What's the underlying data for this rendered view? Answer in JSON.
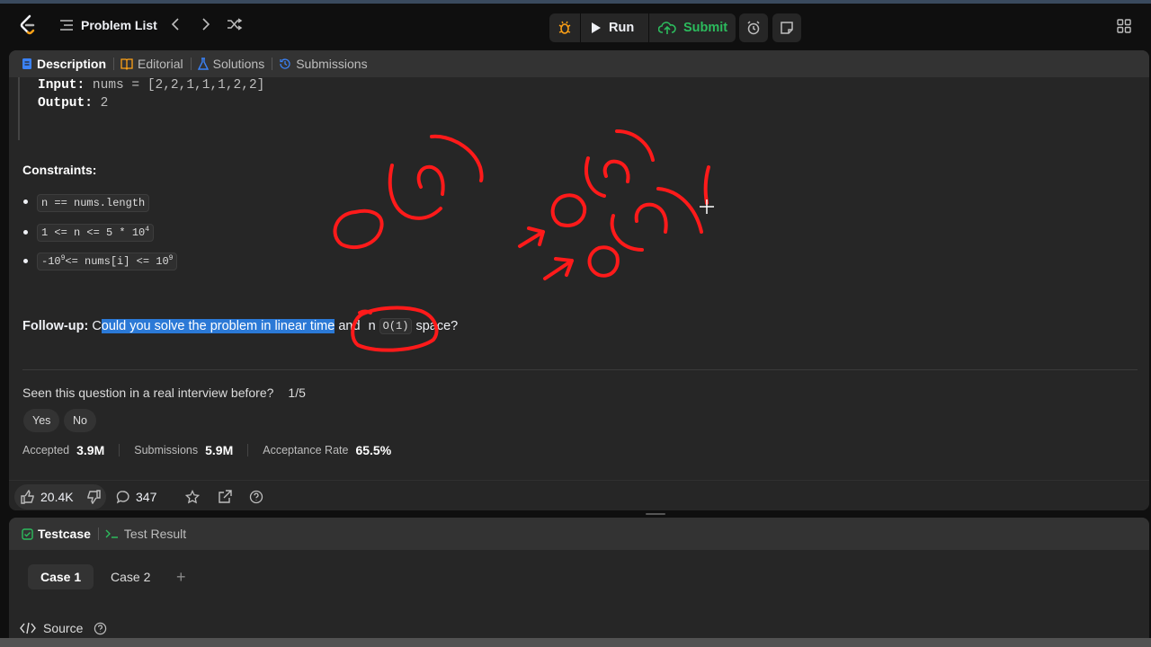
{
  "header": {
    "problem_list": "Problem List",
    "run": "Run",
    "submit": "Submit"
  },
  "tabs": {
    "description": "Description",
    "editorial": "Editorial",
    "solutions": "Solutions",
    "submissions": "Submissions"
  },
  "example": {
    "input_label": "Input:",
    "input_value": "nums = [2,2,1,1,1,2,2]",
    "output_label": "Output:",
    "output_value": "2"
  },
  "constraints": {
    "title": "Constraints:",
    "items": [
      "n == nums.length",
      "1 <= n <= 5 * 10",
      "-10",
      "<= nums[i] <= 10"
    ],
    "exp4": "4",
    "exp9": "9"
  },
  "followup": {
    "label": "Follow-up:",
    "pre": "C",
    "highlight": "ould you solve the problem in linear time",
    "mid": " and ",
    "n_text": "n",
    "code": "O(1)",
    "post": "space?"
  },
  "interview": {
    "question": "Seen this question in a real interview before?",
    "ratio": "1/5",
    "yes": "Yes",
    "no": "No"
  },
  "stats": {
    "accepted_label": "Accepted",
    "accepted_value": "3.9M",
    "submissions_label": "Submissions",
    "submissions_value": "5.9M",
    "rate_label": "Acceptance Rate",
    "rate_value": "65.5%"
  },
  "reactions": {
    "likes": "20.4K",
    "comments": "347"
  },
  "testcase": {
    "tab": "Testcase",
    "result_tab": "Test Result",
    "case1": "Case 1",
    "case2": "Case 2",
    "add": "+"
  },
  "source": {
    "label": "Source"
  },
  "colors": {
    "accent_green": "#2cbb5d",
    "accent_blue": "#3b82f6",
    "highlight": "#2b79d6",
    "annotation_red": "#ff1a1a"
  }
}
